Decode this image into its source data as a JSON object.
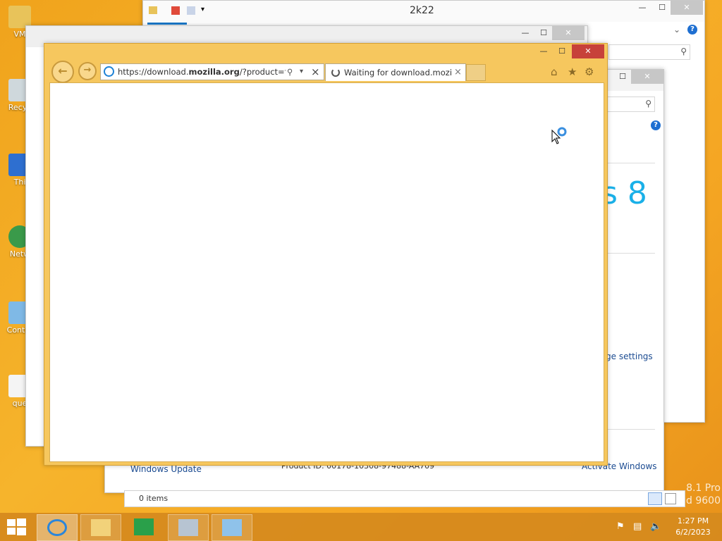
{
  "desktop": {
    "icons": [
      {
        "label": "VM"
      },
      {
        "label": "Recyc"
      },
      {
        "label": "Thi"
      },
      {
        "label": "Netw"
      },
      {
        "label": "Contro"
      },
      {
        "label": "que"
      }
    ],
    "watermark_line1": "8.1 Pro",
    "watermark_line2": "d 9600"
  },
  "explorer": {
    "title": "2k22",
    "status_items": "0 items",
    "help_glyph": "?"
  },
  "system_window": {
    "windows_8_text": "s 8",
    "change_settings": "ge settings",
    "windows_update": "Windows Update",
    "product_id": "Product ID: 00178-10308-97488-AA709",
    "activate": "Activate Windows"
  },
  "ie": {
    "address": "https://download.mozilla.org/?product=firef",
    "address_host": "mozilla.org",
    "tab_title": "Waiting for download.mozi...",
    "close_glyph": "×"
  },
  "taskbar": {
    "time": "1:27 PM",
    "date": "6/2/2023"
  },
  "colors": {
    "desktop_orange": "#f5a623",
    "ie_frame": "#f6c75e",
    "close_red": "#c7413a",
    "link_blue": "#1b4b91"
  }
}
